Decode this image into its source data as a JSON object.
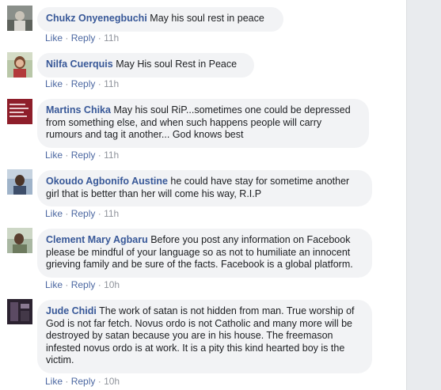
{
  "comments": [
    {
      "author": "Chukz Onyenegbuchi",
      "text": "May his soul rest in peace",
      "like": "Like",
      "reply": "Reply",
      "time": "11h"
    },
    {
      "author": "Nilfa Cuerquis",
      "text": "May His soul Rest in Peace",
      "like": "Like",
      "reply": "Reply",
      "time": "11h"
    },
    {
      "author": "Martins Chika",
      "text": "May his soul RiP...sometimes one could be depressed from something else, and when such happens people will carry rumours and tag it another... God knows best",
      "like": "Like",
      "reply": "Reply",
      "time": "11h"
    },
    {
      "author": "Okoudo Agbonifo Austine",
      "text": "he could have stay for sometime another girl that is better than her will come his way, R.I.P",
      "like": "Like",
      "reply": "Reply",
      "time": "11h"
    },
    {
      "author": "Clement Mary Agbaru",
      "text": "Before you post any information on Facebook please be mindful of your language so as not to humiliate an innocent grieving family and be sure of the facts. Facebook is a global platform.",
      "like": "Like",
      "reply": "Reply",
      "time": "10h"
    },
    {
      "author": "Jude Chidi",
      "text": "The work of satan is not hidden from man. True worship of God is not far fetch. Novus ordo is not Catholic and many more will be destroyed by satan because you are in his house. The freemason infested novus ordo is at work. It is a pity this kind hearted boy is the victim.",
      "like": "Like",
      "reply": "Reply",
      "time": "10h"
    }
  ],
  "separator": "·"
}
